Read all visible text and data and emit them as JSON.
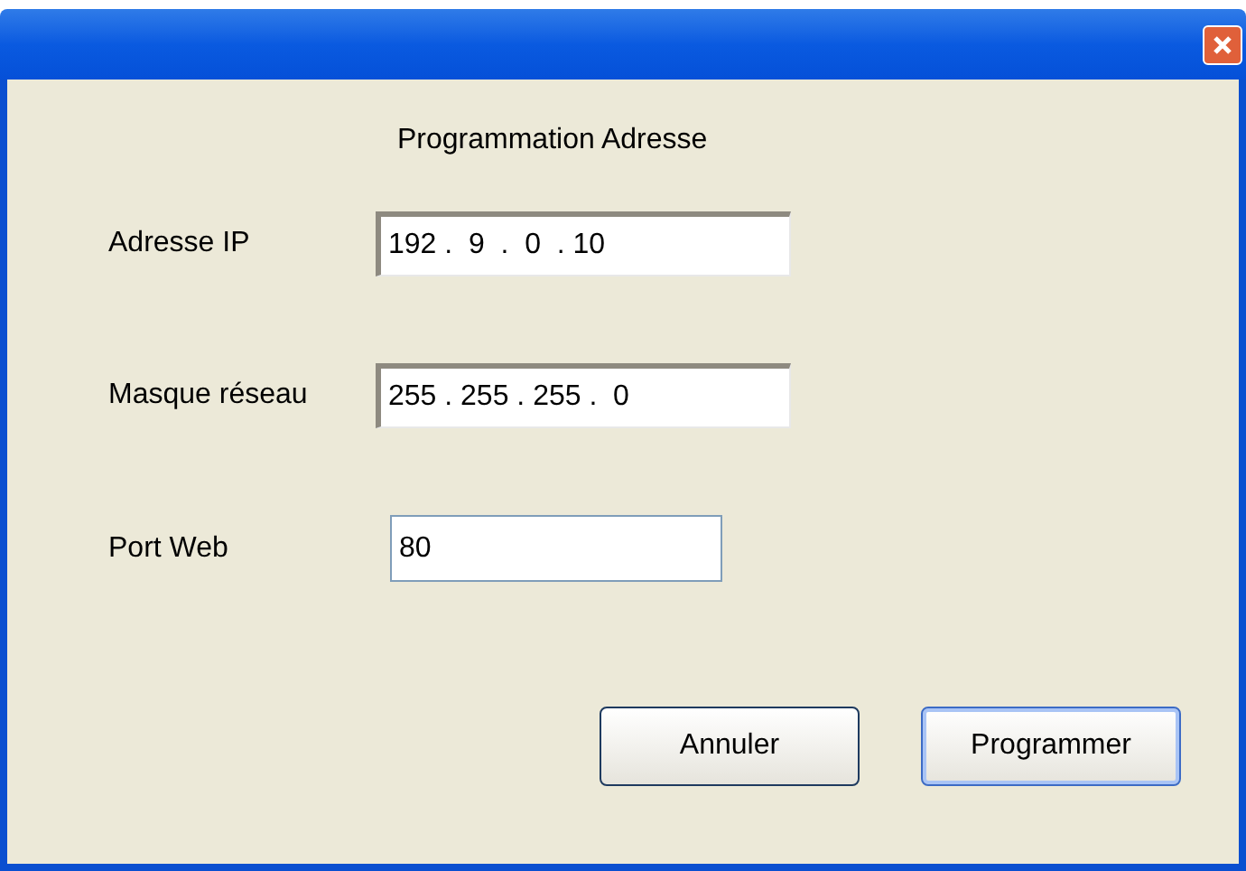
{
  "window": {
    "title": "Programmation Adresse"
  },
  "fields": [
    {
      "label": "Adresse IP",
      "kind": "ip",
      "value": "192 .  9  .  0  . 10"
    },
    {
      "label": "Masque réseau",
      "kind": "ip",
      "value": "255 . 255 . 255 .  0"
    },
    {
      "label": "Port Web",
      "kind": "text",
      "value": "80"
    }
  ],
  "buttons": [
    {
      "label": "Annuler",
      "default": false
    },
    {
      "label": "Programmer",
      "default": true
    }
  ]
}
